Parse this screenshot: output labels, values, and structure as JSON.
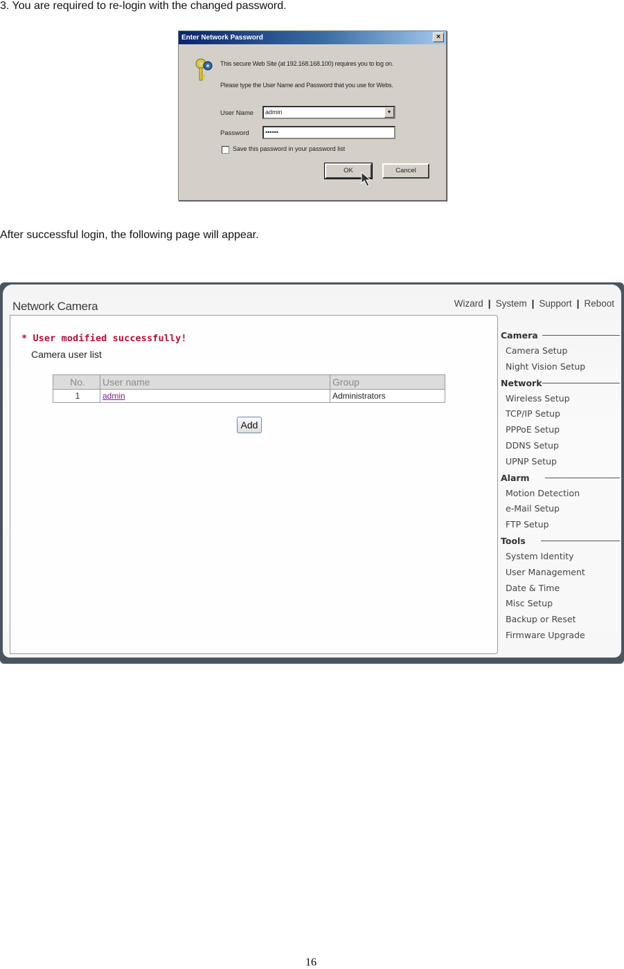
{
  "document": {
    "step_text": "3. You are required to re-login with the changed password.",
    "after_text": "After successful login, the following page will appear.",
    "page_number": "16"
  },
  "login_dialog": {
    "title": "Enter Network Password",
    "close_glyph": "×",
    "line1": "This secure Web Site (at 192.168.168.100) requires you to log on.",
    "line2": "Please type the User Name and Password that you use for Webs.",
    "username_label": "User Name",
    "username_value": "admin",
    "password_label": "Password",
    "password_value": "••••••",
    "save_password_label": "Save this password in your password list",
    "save_password_checked": false,
    "ok_label": "OK",
    "cancel_label": "Cancel",
    "dropdown_glyph": "▼"
  },
  "camera_page": {
    "app_title": "Network Camera",
    "top_nav": [
      {
        "label": "Wizard"
      },
      {
        "label": "System"
      },
      {
        "label": "Support"
      },
      {
        "label": "Reboot"
      }
    ],
    "nav_separator": "|",
    "status_message": "* User modified successfully!",
    "section_title": "Camera user list",
    "table": {
      "headers": [
        "No.",
        "User name",
        "Group"
      ],
      "rows": [
        {
          "no": "1",
          "user_name": "admin",
          "group": "Administrators"
        }
      ]
    },
    "add_button_label": "Add",
    "sidebar": {
      "groups": [
        {
          "title": "Camera",
          "items": [
            "Camera Setup",
            "Night Vision Setup"
          ]
        },
        {
          "title": "Network",
          "items": [
            "Wireless Setup",
            "TCP/IP Setup",
            "PPPoE Setup",
            "DDNS Setup",
            "UPNP Setup"
          ]
        },
        {
          "title": "Alarm",
          "items": [
            "Motion Detection",
            "e-Mail Setup",
            "FTP Setup"
          ]
        },
        {
          "title": "Tools",
          "items": [
            "System Identity",
            "User Management",
            "Date & Time",
            "Misc Setup",
            "Backup or Reset",
            "Firmware Upgrade"
          ]
        }
      ]
    },
    "colors": {
      "status_message": "#b0103a",
      "link": "#7a1a9a"
    }
  }
}
